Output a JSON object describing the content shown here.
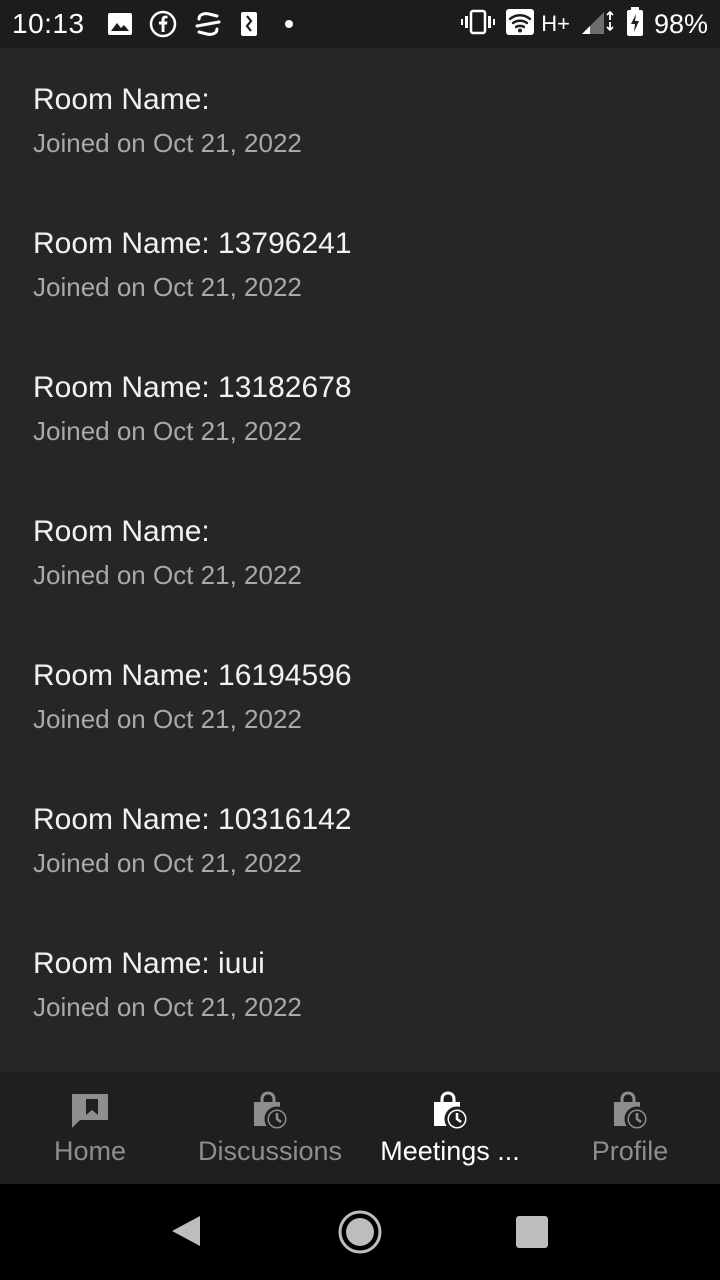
{
  "status_bar": {
    "time": "10:13",
    "network_type": "H+",
    "battery_percent": "98%",
    "left_icons": [
      "image-icon",
      "facebook-icon",
      "swiftkey-icon",
      "app-icon"
    ],
    "right_icons": [
      "vibrate-icon",
      "wifi-icon",
      "signal-icon",
      "battery-charging-icon"
    ]
  },
  "rooms": [
    {
      "title": "Room Name: ",
      "joined": "Joined on Oct 21, 2022"
    },
    {
      "title": "Room Name: 13796241",
      "joined": "Joined on Oct 21, 2022"
    },
    {
      "title": "Room Name: 13182678",
      "joined": "Joined on Oct 21, 2022"
    },
    {
      "title": "Room Name: ",
      "joined": "Joined on Oct 21, 2022"
    },
    {
      "title": "Room Name: 16194596",
      "joined": "Joined on Oct 21, 2022"
    },
    {
      "title": "Room Name: 10316142",
      "joined": "Joined on Oct 21, 2022"
    },
    {
      "title": "Room Name: iuui",
      "joined": "Joined on Oct 21, 2022"
    }
  ],
  "bottom_nav": {
    "items": [
      {
        "label": "Home",
        "icon": "feedback-bookmark-icon",
        "active": false
      },
      {
        "label": "Discussions",
        "icon": "bag-clock-icon",
        "active": false
      },
      {
        "label": "Meetings ...",
        "icon": "bag-clock-icon",
        "active": true
      },
      {
        "label": "Profile",
        "icon": "bag-clock-icon",
        "active": false
      }
    ]
  },
  "colors": {
    "background": "#262626",
    "nav_background": "#1f1f1f",
    "title_text": "#f2f2f2",
    "subtitle_text": "#a9a9a9",
    "nav_inactive": "#8e8e8e",
    "nav_active": "#ffffff"
  }
}
